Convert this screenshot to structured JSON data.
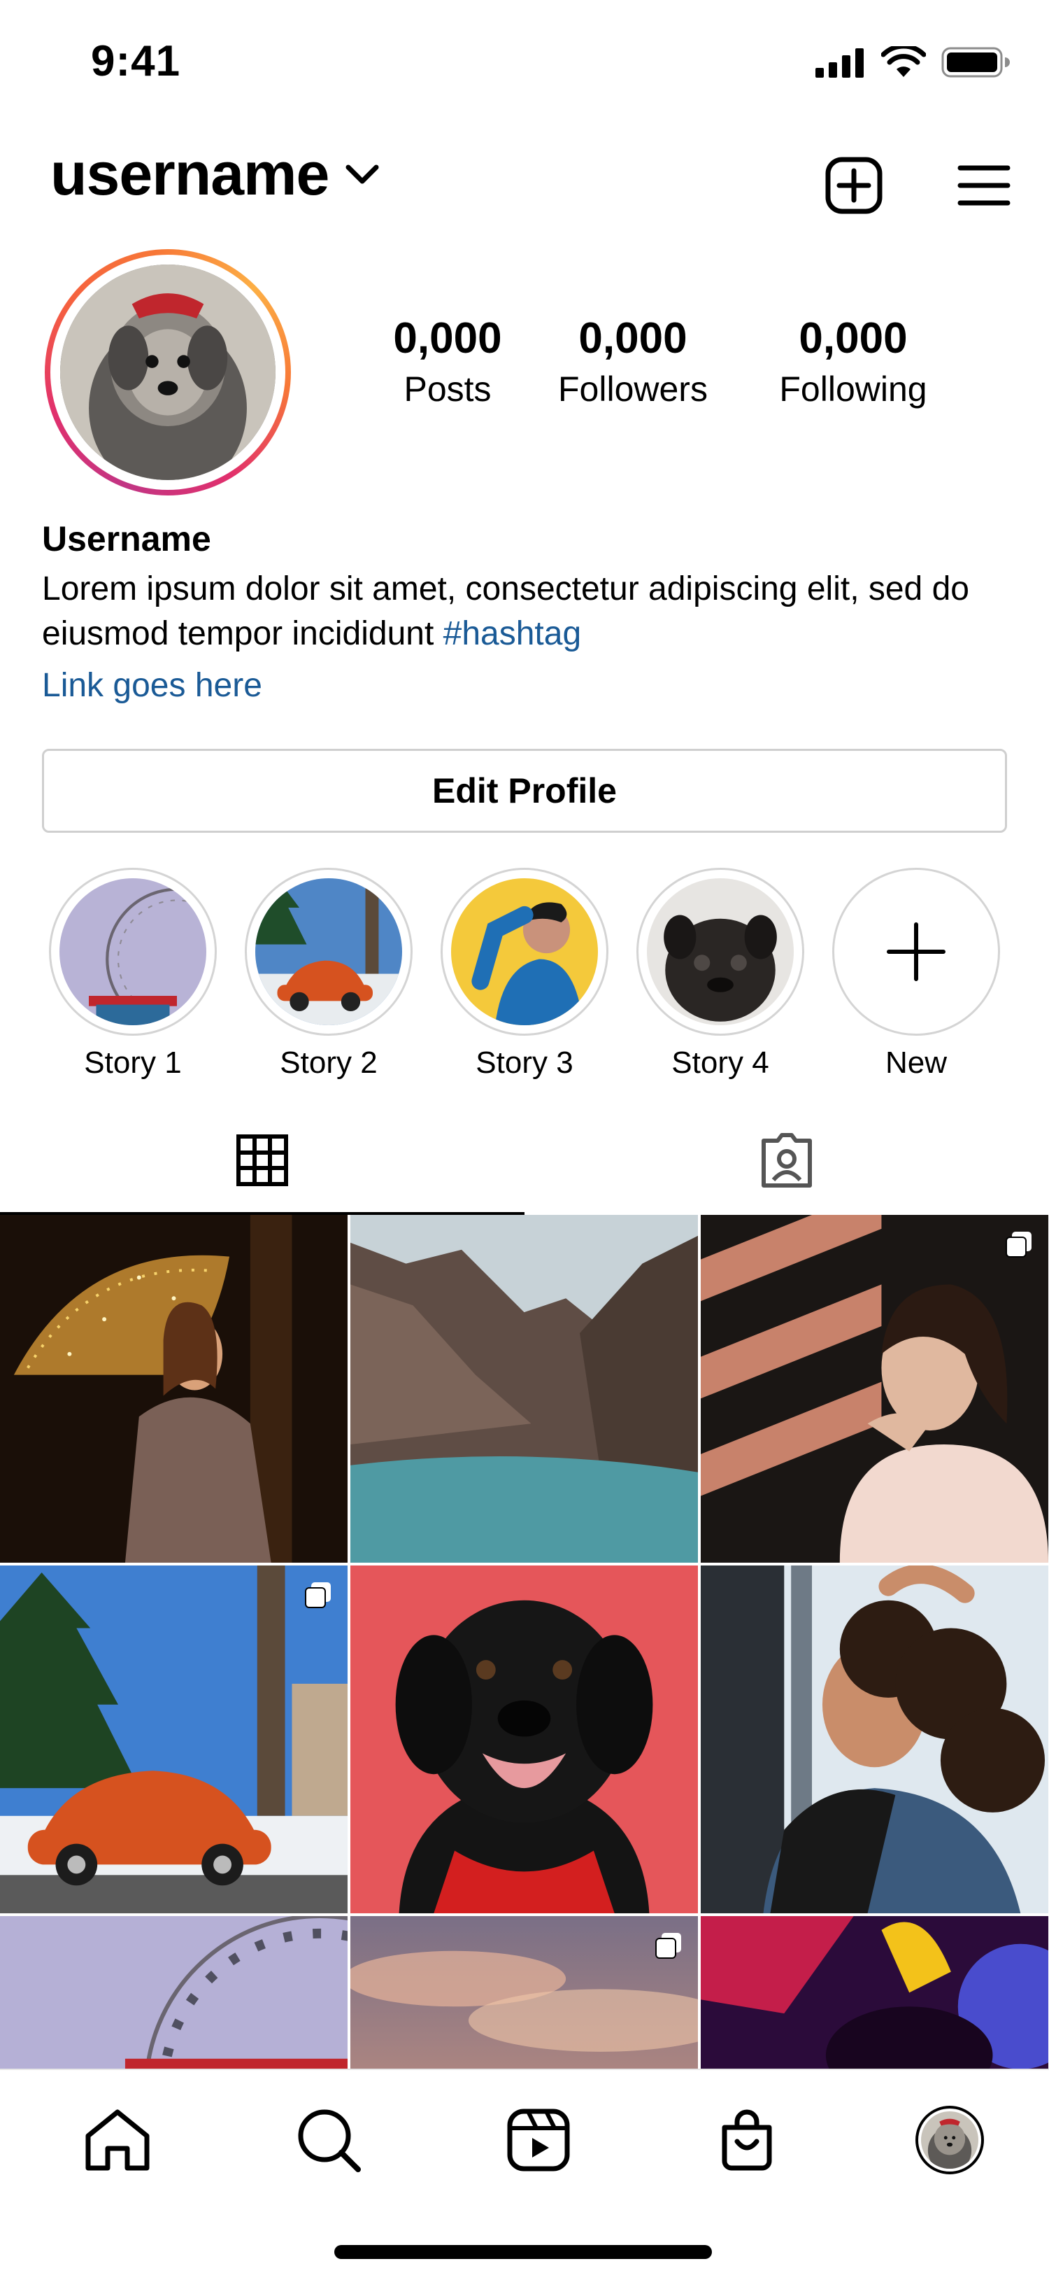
{
  "status_bar": {
    "time": "9:41"
  },
  "header": {
    "username": "username"
  },
  "stats": [
    {
      "value": "0,000",
      "label": "Posts"
    },
    {
      "value": "0,000",
      "label": "Followers"
    },
    {
      "value": "0,000",
      "label": "Following"
    }
  ],
  "bio": {
    "name": "Username",
    "text": "Lorem ipsum dolor sit amet, consectetur adipiscing elit, sed do eiusmod tempor incididunt ",
    "hashtag": "#hashtag",
    "link": "Link goes here"
  },
  "edit_button": {
    "label": "Edit Profile"
  },
  "highlights": [
    {
      "label": "Story 1"
    },
    {
      "label": "Story 2"
    },
    {
      "label": "Story 3"
    },
    {
      "label": "Story 4"
    },
    {
      "label": "New"
    }
  ],
  "tabs": [
    {
      "icon": "grid-icon",
      "active": true
    },
    {
      "icon": "tagged-icon",
      "active": false
    }
  ],
  "nav": [
    {
      "icon": "home-icon"
    },
    {
      "icon": "search-icon"
    },
    {
      "icon": "reels-icon"
    },
    {
      "icon": "shop-icon"
    },
    {
      "icon": "profile-avatar"
    }
  ],
  "colors": {
    "link": "#1a5a96",
    "text": "#000000",
    "border": "#cfcfcf"
  }
}
